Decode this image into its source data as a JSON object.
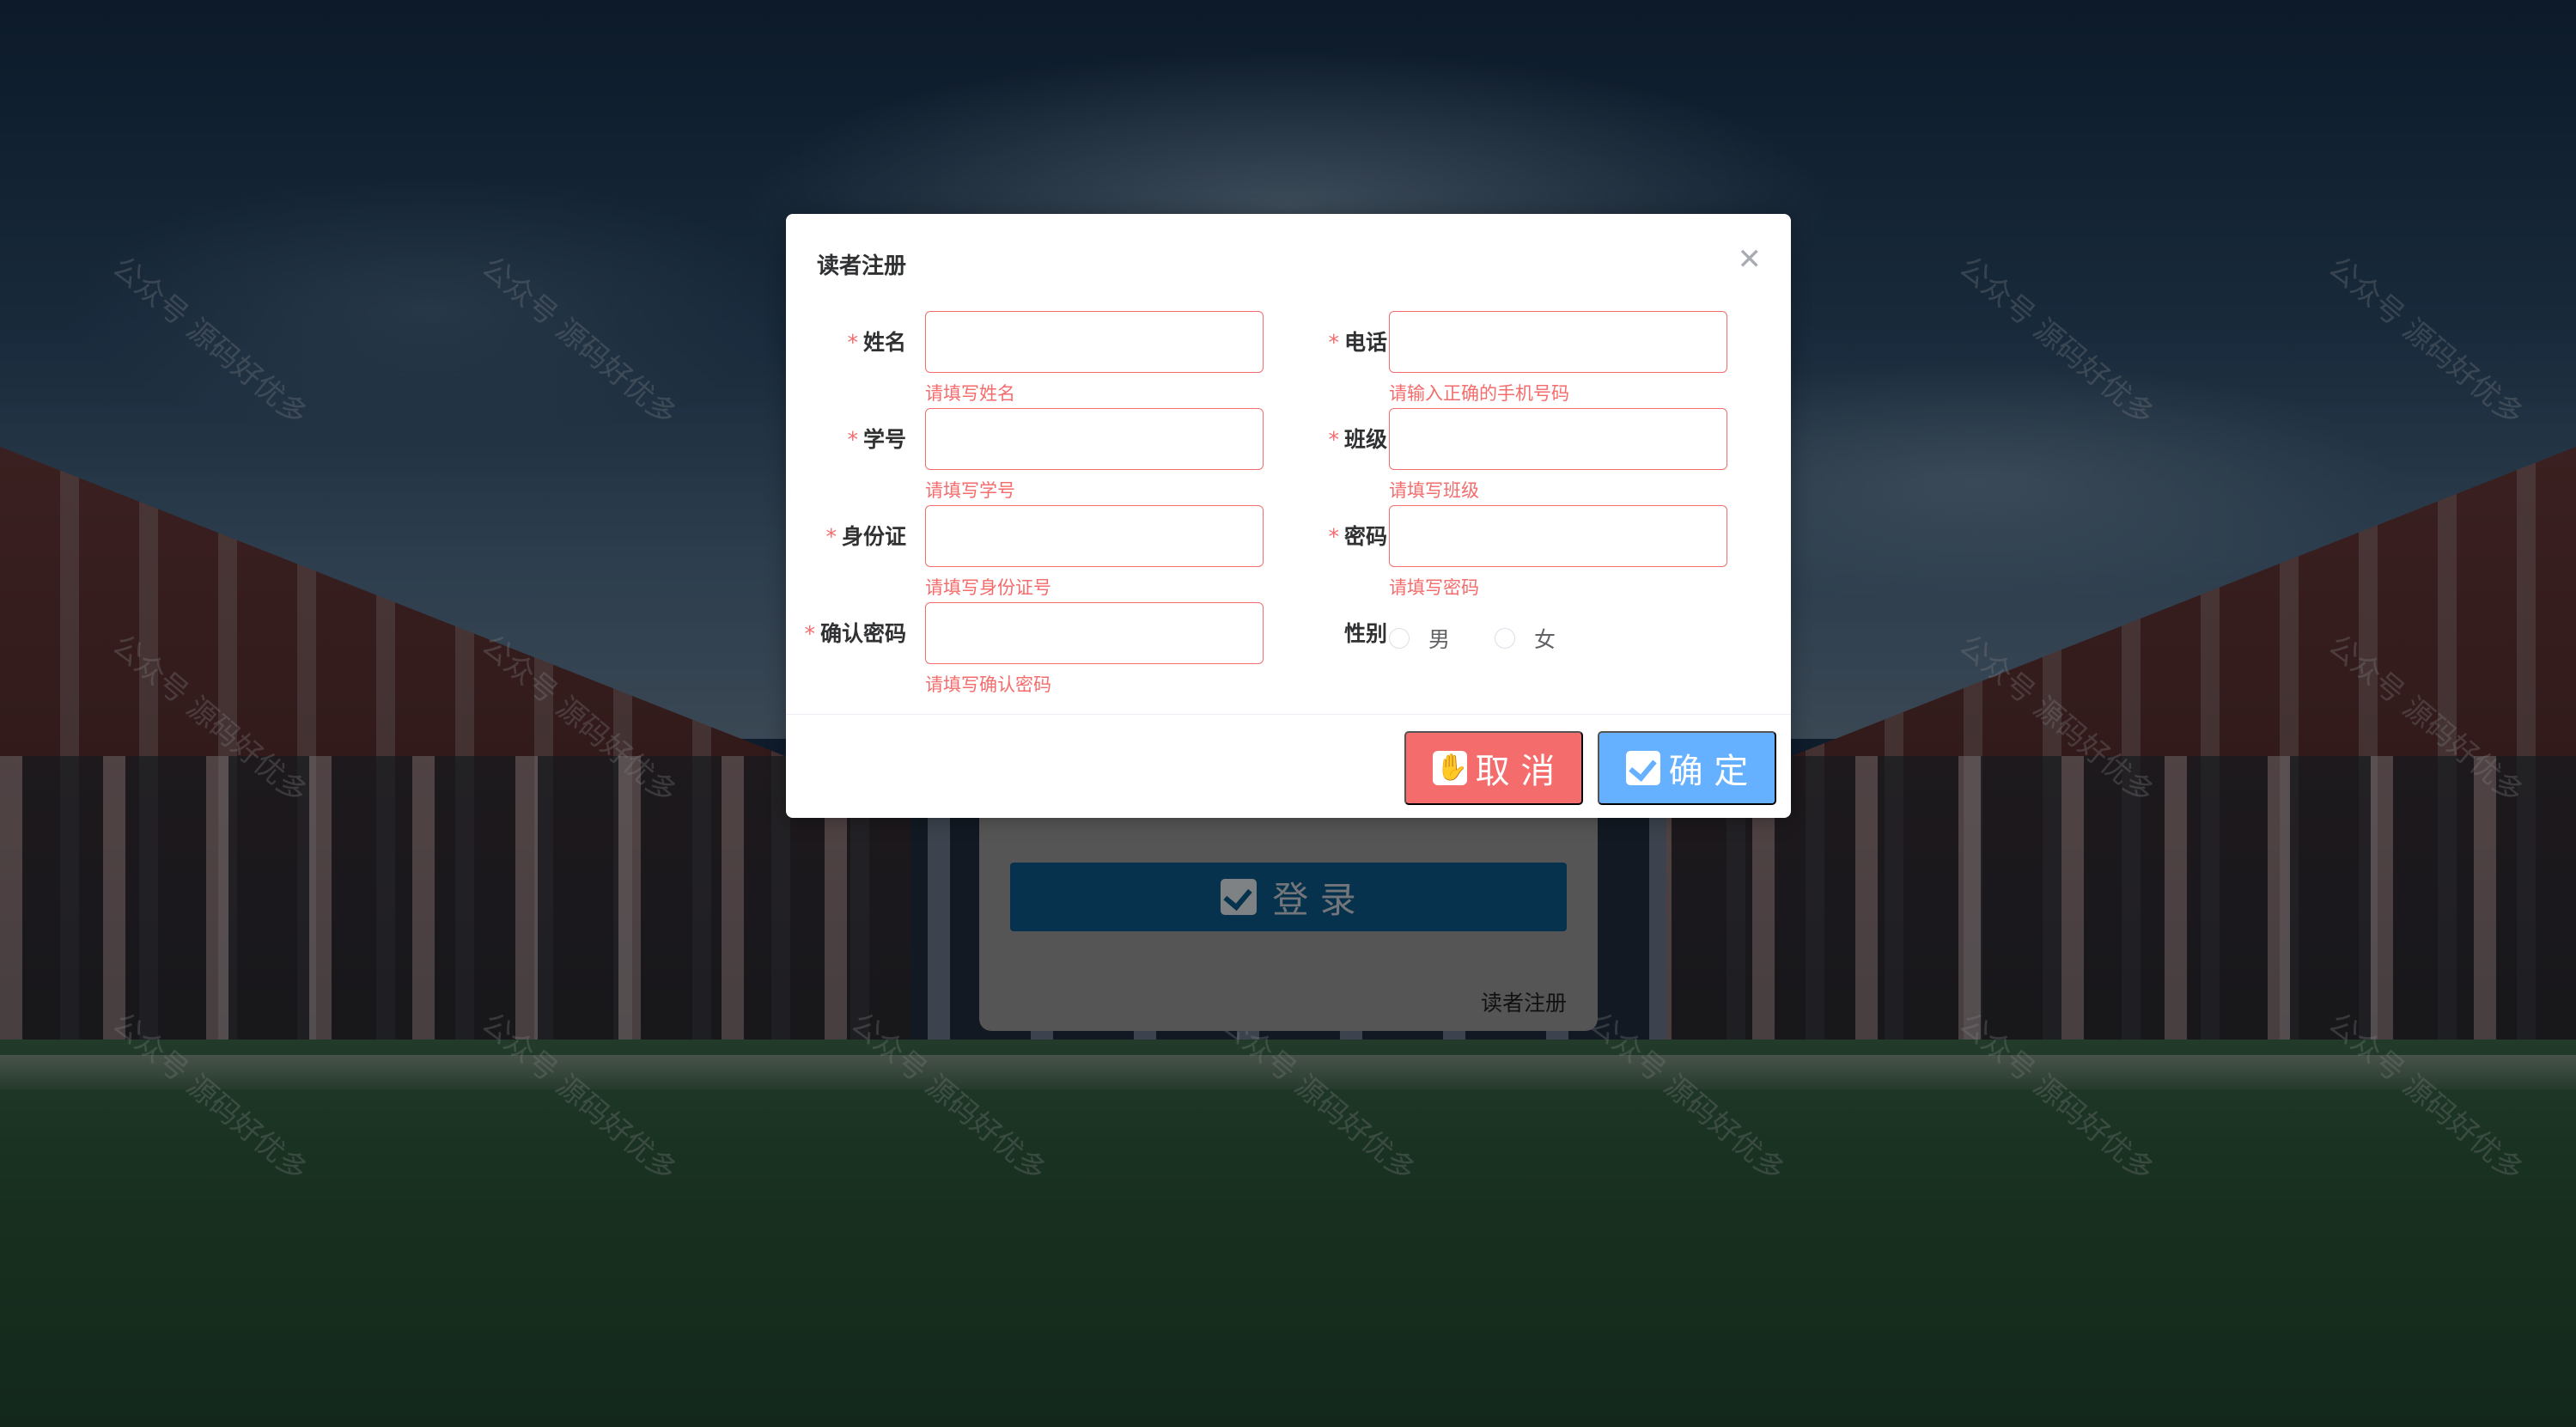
{
  "colors": {
    "dialog_bg": "#ffffff",
    "error": "#f56c6c",
    "cancel_bg": "#f56c6c",
    "confirm_bg": "#66b1ff",
    "login_bg": "#0e5b8c",
    "mask": "rgba(0,0,0,0.45)"
  },
  "watermark": {
    "text": "公众号 源码好优多"
  },
  "login": {
    "button_label": "登 录",
    "button_icon": "check-square-icon",
    "register_link": "读者注册"
  },
  "dialog": {
    "title": "读者注册",
    "close_icon": "close-icon",
    "fields": {
      "name": {
        "label": "姓名",
        "required": "*",
        "value": "",
        "error": "请填写姓名"
      },
      "phone": {
        "label": "电话",
        "required": "*",
        "value": "",
        "error": "请输入正确的手机号码"
      },
      "student_id": {
        "label": "学号",
        "required": "*",
        "value": "",
        "error": "请填写学号"
      },
      "class": {
        "label": "班级",
        "required": "*",
        "value": "",
        "error": "请填写班级"
      },
      "id_card": {
        "label": "身份证",
        "required": "*",
        "value": "",
        "error": "请填写身份证号"
      },
      "password": {
        "label": "密码",
        "required": "*",
        "value": "",
        "error": "请填写密码"
      },
      "confirm_password": {
        "label": "确认密码",
        "required": "*",
        "value": "",
        "error": "请填写确认密码"
      }
    },
    "gender": {
      "label": "性别",
      "options": [
        "男",
        "女"
      ],
      "selected": null
    },
    "buttons": {
      "cancel": {
        "label": "取 消",
        "icon": "hand-icon"
      },
      "confirm": {
        "label": "确 定",
        "icon": "check-square-icon"
      }
    }
  }
}
